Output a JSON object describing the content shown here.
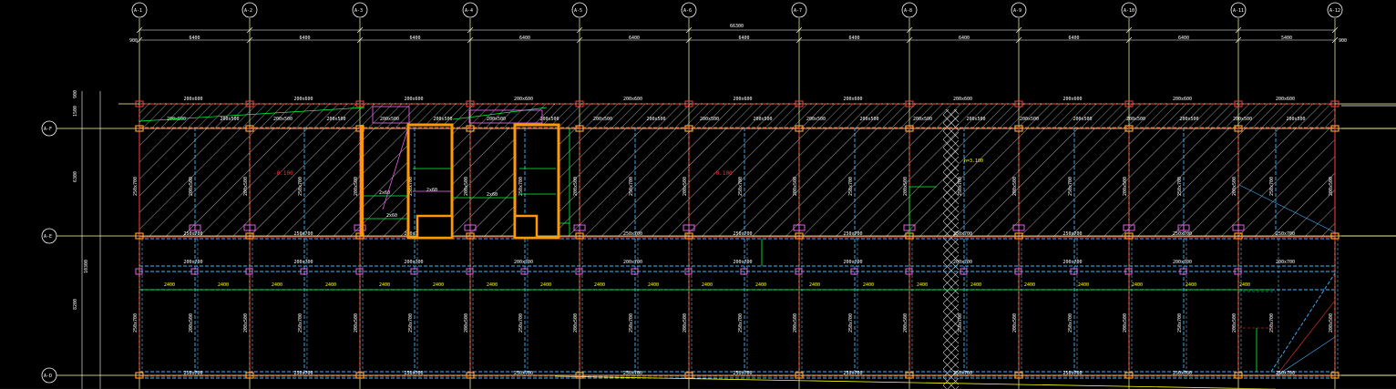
{
  "drawing": {
    "axis_labels_top": [
      "A-1",
      "A-2",
      "A-3",
      "A-4",
      "A-5",
      "A-6",
      "A-7",
      "A-8",
      "A-9",
      "A-10",
      "A-11",
      "A-12"
    ],
    "axis_labels_left": [
      "A-F",
      "A-E",
      "A-D"
    ],
    "overall_dimension": "66300",
    "bay_dimensions": [
      "6400",
      "6400",
      "6400",
      "6400",
      "6400",
      "6400",
      "6400",
      "6400",
      "6400",
      "6400",
      "5400"
    ],
    "edge_dimension": "900",
    "left_dimensions": [
      "900",
      "1500",
      "6300",
      "10300",
      "8200"
    ],
    "top_edge_beams": [
      "200x600",
      "200x600",
      "200x600",
      "200x600",
      "200x600",
      "200x600",
      "200x600",
      "200x600",
      "200x600",
      "200x600",
      "200x600"
    ],
    "row1_beams": [
      "250x700",
      "250x700",
      "250x700",
      "250x700",
      "250x700",
      "250x700",
      "250x700",
      "250x700",
      "250x700",
      "250x700",
      "250x700"
    ],
    "row2_beams": [
      "200x700",
      "200x700",
      "200x700",
      "200x700",
      "200x700",
      "200x700",
      "200x700",
      "200x700",
      "200x700",
      "200x700",
      "200x700"
    ],
    "row3_beams": [
      "250x700",
      "250x700",
      "250x700",
      "250x700",
      "250x700",
      "250x700",
      "250x700",
      "250x700",
      "250x700",
      "250x700",
      "250x700"
    ],
    "secondary_beams": [
      "200x500",
      "200x500",
      "200x500",
      "200x500",
      "200x500",
      "200x500",
      "200x500",
      "200x500",
      "200x500",
      "200x500",
      "200x500",
      "200x500",
      "200x500",
      "200x500",
      "200x500",
      "200x500",
      "200x500",
      "200x500",
      "200x500",
      "200x500",
      "200x500",
      "200x500"
    ],
    "vertical_beams": [
      "250x700",
      "200x500",
      "200x500",
      "250x700",
      "200x500",
      "250x700",
      "200x500",
      "250x700",
      "200x500",
      "250x700",
      "200x500",
      "250x700",
      "200x500",
      "250x700",
      "200x500",
      "250x700",
      "200x500",
      "250x700",
      "200x500",
      "250x700",
      "200x500",
      "250x700",
      "200x500"
    ],
    "slab_labels": [
      "-0.100",
      "-0.100"
    ],
    "stair_labels": [
      "2x60",
      "2x60",
      "2x60",
      "2x60"
    ],
    "elevation_note": "h=3.100",
    "slab_thickness_labels": [
      "2400",
      "2400",
      "2400",
      "2400",
      "2400",
      "2400",
      "2400",
      "2400",
      "2400",
      "2400",
      "2400",
      "2400",
      "2400",
      "2400",
      "2400",
      "2400",
      "2400",
      "2400",
      "2400",
      "2400",
      "2400",
      "2400"
    ],
    "colors": {
      "background": "#000000",
      "axis": "#ffff66",
      "dimension": "#ffffff",
      "beam_dashed_cyan": "#3fb6ff",
      "beam_dashed_red": "#ff3c3c",
      "hatch": "#d8d8d8",
      "stair": "#ff9900",
      "green": "#00ff3c",
      "column_magenta": "#ff66ff",
      "column_orange": "#ff9a1e"
    }
  }
}
